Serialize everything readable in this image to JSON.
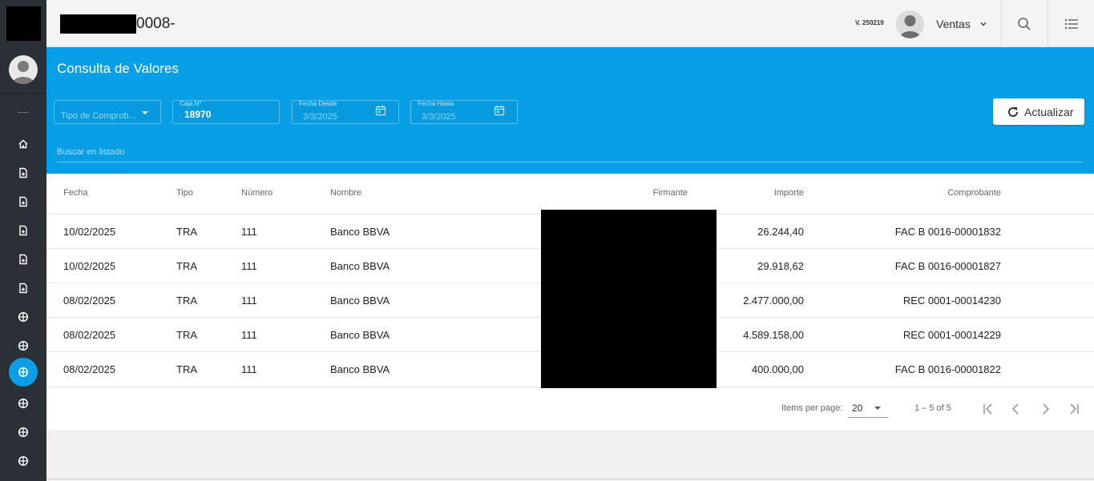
{
  "header": {
    "title_suffix": "0008-",
    "version": "V. 250219",
    "user_name": "Ventas"
  },
  "sidebar": {
    "items": [
      {
        "icon": "home-icon"
      },
      {
        "icon": "document-icon"
      },
      {
        "icon": "document-icon"
      },
      {
        "icon": "document-icon"
      },
      {
        "icon": "document-icon"
      },
      {
        "icon": "document-icon"
      },
      {
        "icon": "circle-icon"
      },
      {
        "icon": "circle-icon"
      },
      {
        "icon": "circle-icon",
        "active": true
      },
      {
        "icon": "circle-icon"
      },
      {
        "icon": "circle-icon"
      },
      {
        "icon": "circle-icon"
      }
    ]
  },
  "page": {
    "title": "Consulta de Valores"
  },
  "filters": {
    "tipo_placeholder": "Tipo de Comprob...",
    "caja_label": "Caja N°",
    "caja_value": "18970",
    "desde_label": "Fecha Desde",
    "desde_value": "3/3/2025",
    "hasta_label": "Fecha Hasta",
    "hasta_value": "3/3/2025",
    "refresh_label": "Actualizar",
    "search_placeholder": "Buscar en listado"
  },
  "table": {
    "columns": [
      "Fecha",
      "Tipo",
      "Número",
      "Nombre",
      "Firmante",
      "Importe",
      "Comprobante"
    ],
    "rows": [
      {
        "fecha": "10/02/2025",
        "tipo": "TRA",
        "numero": "111",
        "nombre": "Banco BBVA",
        "importe": "26.244,40",
        "comprobante": "FAC B 0016-00001832"
      },
      {
        "fecha": "10/02/2025",
        "tipo": "TRA",
        "numero": "111",
        "nombre": "Banco BBVA",
        "importe": "29.918,62",
        "comprobante": "FAC B 0016-00001827"
      },
      {
        "fecha": "08/02/2025",
        "tipo": "TRA",
        "numero": "111",
        "nombre": "Banco BBVA",
        "importe": "2.477.000,00",
        "comprobante": "REC 0001-00014230"
      },
      {
        "fecha": "08/02/2025",
        "tipo": "TRA",
        "numero": "111",
        "nombre": "Banco BBVA",
        "importe": "4.589.158,00",
        "comprobante": "REC 0001-00014229"
      },
      {
        "fecha": "08/02/2025",
        "tipo": "TRA",
        "numero": "111",
        "nombre": "Banco BBVA",
        "importe": "400.000,00",
        "comprobante": "FAC B 0016-00001822"
      }
    ]
  },
  "paginator": {
    "items_label": "Items per page:",
    "page_size": "20",
    "range": "1 – 5 of 5"
  },
  "colors": {
    "accent": "#089fe6",
    "sidebar": "#2b2f36"
  }
}
